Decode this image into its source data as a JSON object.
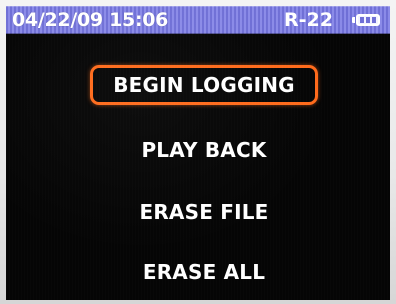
{
  "status_bar": {
    "datetime": "04/22/09 15:06",
    "channel": "R-22",
    "battery_icon": "battery-icon",
    "battery_level": 0.75
  },
  "menu": {
    "items": [
      {
        "label": "BEGIN LOGGING",
        "selected": true
      },
      {
        "label": "PLAY BACK",
        "selected": false
      },
      {
        "label": "ERASE FILE",
        "selected": false
      },
      {
        "label": "ERASE ALL",
        "selected": false
      }
    ]
  },
  "colors": {
    "status_bar": "#7c7ce0",
    "screen_background": "#050505",
    "text": "#ffffff",
    "selection_border": "#ff6a1a"
  }
}
